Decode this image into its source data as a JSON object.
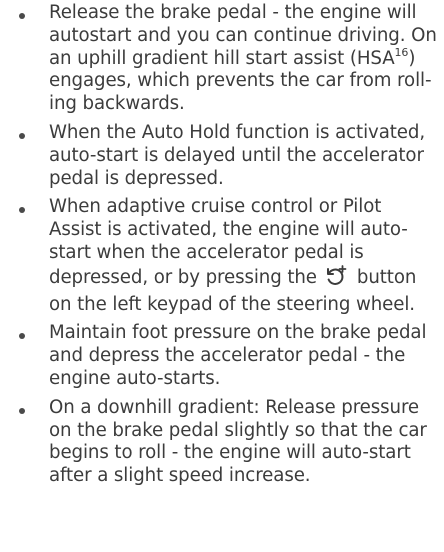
{
  "bullets": [
    {
      "lines": [
        "Release the brake pedal - the engine will",
        "autostart and you can continue driving. On",
        "an uphill gradient hill start assist (HSA",
        "engages, which prevents the car from roll-",
        "ing backwards."
      ],
      "footnote_ref": "16",
      "hsa_close": ")"
    },
    {
      "lines": [
        "When the Auto Hold function is activated,",
        "auto-start is delayed until the accelerator",
        "pedal is depressed."
      ]
    },
    {
      "lines": [
        "When adaptive cruise control or Pilot",
        "Assist is activated, the engine will auto-",
        "start when the accelerator pedal is",
        "depressed, or by pressing the",
        "button",
        "on the left keypad of the steering wheel."
      ],
      "icon": "resume-plus-icon"
    },
    {
      "lines": [
        "Maintain foot pressure on the brake pedal",
        "and depress the accelerator pedal - the",
        "engine auto-starts."
      ]
    },
    {
      "lines": [
        "On a downhill gradient: Release pressure",
        "on the brake pedal slightly so that the car",
        "begins to roll - the engine will auto-start",
        "after a slight speed increase."
      ]
    }
  ]
}
